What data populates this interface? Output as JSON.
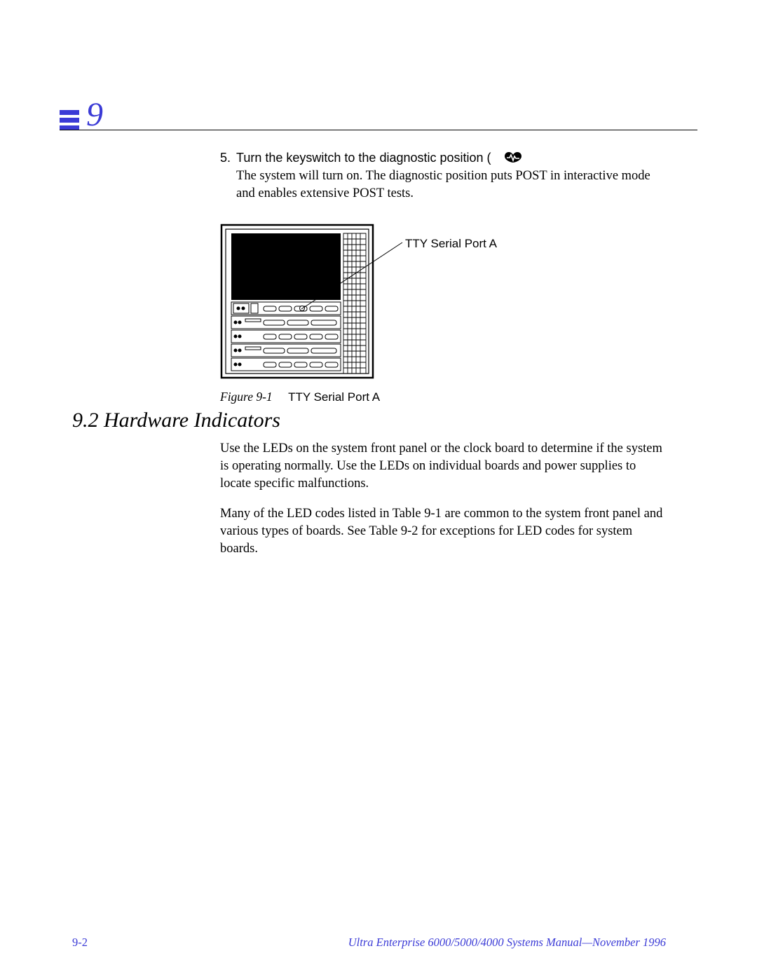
{
  "chapter": {
    "number": "9"
  },
  "step5": {
    "number": "5.",
    "lead": "Turn the keyswitch to the diagnostic position (",
    "rest": "The system will turn on. The diagnostic position puts POST in interactive mode and enables extensive POST tests."
  },
  "figure1": {
    "callout": "TTY Serial Port A",
    "label": "Figure 9-1",
    "title": "TTY Serial Port A"
  },
  "section": {
    "heading": "9.2  Hardware Indicators",
    "p1": "Use the LEDs on the system front panel or the clock board to determine if the system is operating normally. Use the LEDs on individual boards and power supplies to locate specific malfunctions.",
    "p2": "Many of the LED codes listed in Table 9-1 are common to the system front panel and various types of boards. See Table 9-2 for exceptions for LED codes for system boards."
  },
  "footer": {
    "page": "9-2",
    "title": "Ultra Enterprise 6000/5000/4000 Systems Manual—November 1996"
  }
}
